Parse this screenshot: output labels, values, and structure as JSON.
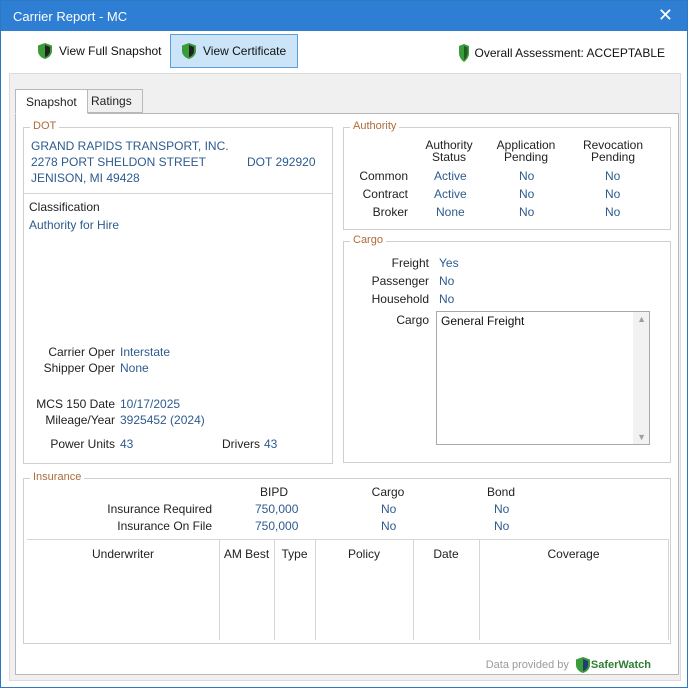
{
  "window": {
    "title": "Carrier Report - MC",
    "close_glyph": "✕"
  },
  "toolbar": {
    "view_full_snapshot": "View Full Snapshot",
    "view_certificate": "View Certificate",
    "overall_assessment": "Overall Assessment: ACCEPTABLE",
    "shield_color": "#3a9b3a"
  },
  "tabs": {
    "snapshot": "Snapshot",
    "ratings": "Ratings"
  },
  "dot": {
    "label": "DOT",
    "name": "GRAND RAPIDS TRANSPORT, INC.",
    "street": "2278 PORT SHELDON STREET",
    "city": "JENISON, MI 49428",
    "dot_number": "DOT 292920",
    "classification_label": "Classification",
    "classification_value": "Authority for Hire",
    "carrier_oper_label": "Carrier Oper",
    "carrier_oper_value": "Interstate",
    "shipper_oper_label": "Shipper Oper",
    "shipper_oper_value": "None",
    "mcs150_label": "MCS 150 Date",
    "mcs150_value": "10/17/2025",
    "mileage_label": "Mileage/Year",
    "mileage_value": "3925452 (2024)",
    "power_units_label": "Power Units",
    "power_units_value": "43",
    "drivers_label": "Drivers",
    "drivers_value": "43"
  },
  "authority": {
    "label": "Authority",
    "col_status_1": "Authority",
    "col_status_2": "Status",
    "col_app_1": "Application",
    "col_app_2": "Pending",
    "col_rev_1": "Revocation",
    "col_rev_2": "Pending",
    "rows": [
      {
        "name": "Common",
        "status": "Active",
        "application": "No",
        "revocation": "No"
      },
      {
        "name": "Contract",
        "status": "Active",
        "application": "No",
        "revocation": "No"
      },
      {
        "name": "Broker",
        "status": "None",
        "application": "No",
        "revocation": "No"
      }
    ]
  },
  "cargo": {
    "label": "Cargo",
    "freight_label": "Freight",
    "freight_value": "Yes",
    "passenger_label": "Passenger",
    "passenger_value": "No",
    "household_label": "Household",
    "household_value": "No",
    "cargo_label": "Cargo",
    "cargo_text": "General Freight"
  },
  "insurance": {
    "label": "Insurance",
    "col_bipd": "BIPD",
    "col_cargo": "Cargo",
    "col_bond": "Bond",
    "required_label": "Insurance Required",
    "required_bipd": "750,000",
    "required_cargo": "No",
    "required_bond": "No",
    "onfile_label": "Insurance On File",
    "onfile_bipd": "750,000",
    "onfile_cargo": "No",
    "onfile_bond": "No",
    "table_headers": [
      "Underwriter",
      "AM Best",
      "Type",
      "Policy",
      "Date",
      "Coverage"
    ]
  },
  "footer": {
    "provided_by": "Data provided by",
    "brand": "SaferWatch"
  }
}
